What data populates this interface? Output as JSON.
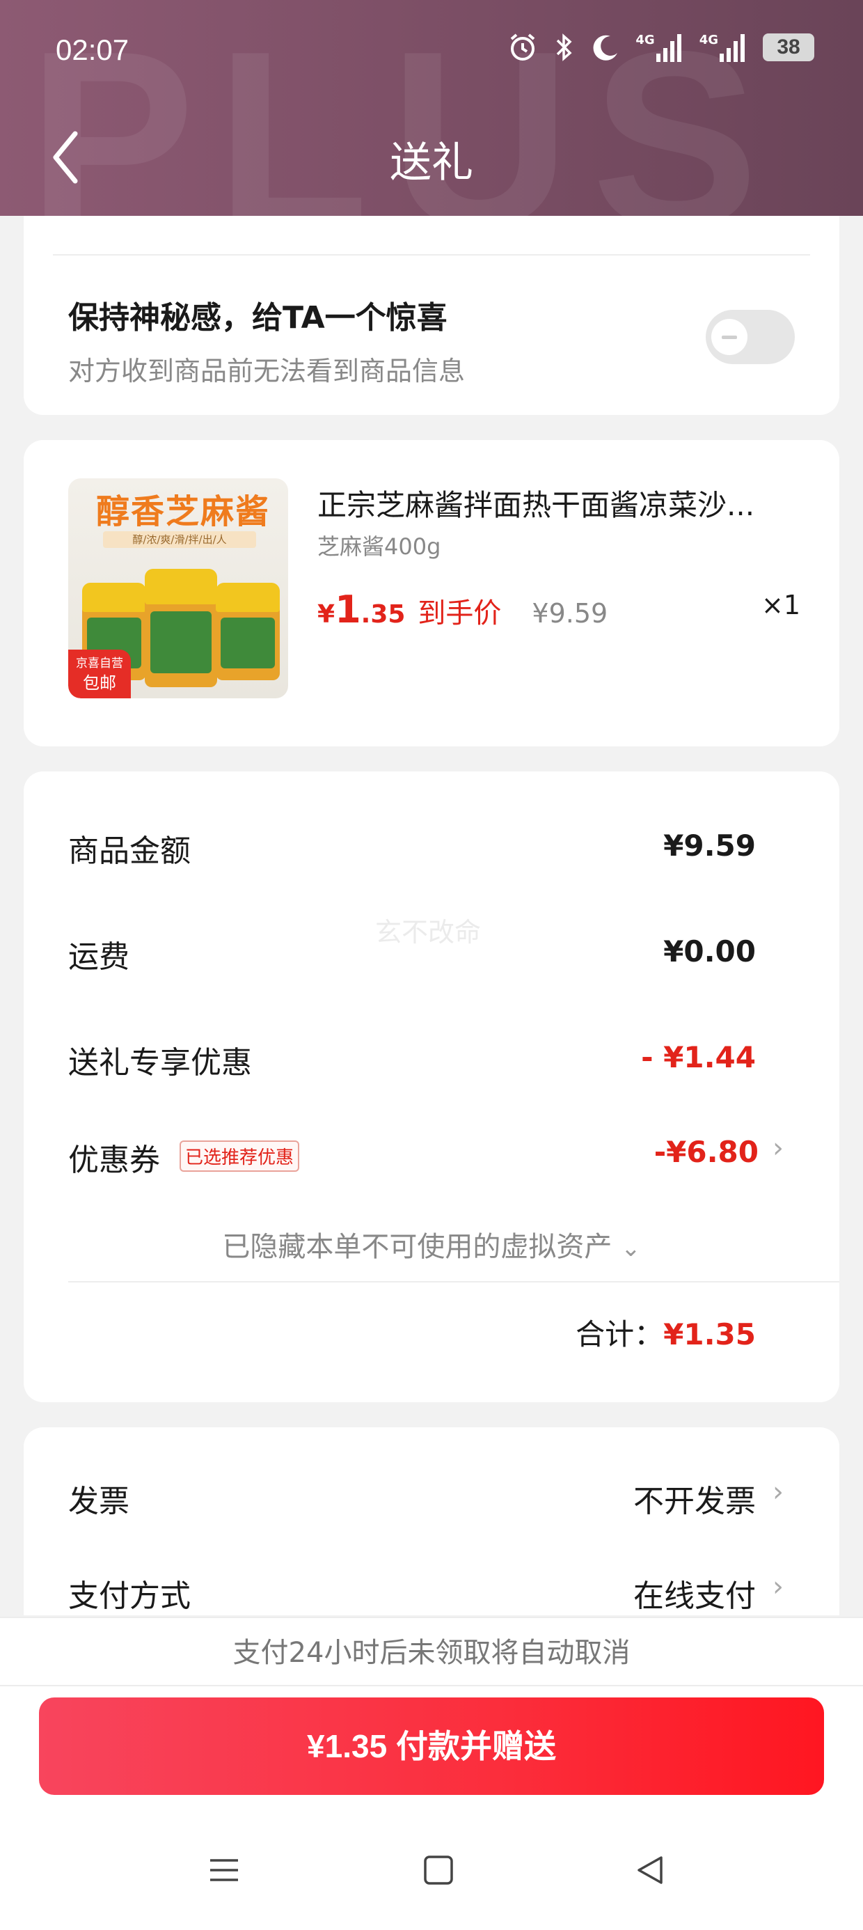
{
  "status_bar": {
    "time": "02:07",
    "network_label": "4G",
    "network_label_2": "4G",
    "battery": "38"
  },
  "header": {
    "title": "送礼",
    "watermark": "PLUS"
  },
  "secret": {
    "title": "保持神秘感，给TA一个惊喜",
    "subtitle": "对方收到商品前无法看到商品信息",
    "toggle_on": false
  },
  "product": {
    "name": "正宗芝麻酱拌面热干面酱凉菜沙...",
    "spec": "芝麻酱400g",
    "price_symbol": "¥",
    "price_int": "1",
    "price_dec": ".35",
    "price_label": "到手价",
    "original_price": "¥9.59",
    "quantity": "×1",
    "image": {
      "title": "醇香芝麻酱",
      "ribbon": "醇/浓/爽/滑/拌/出/人",
      "badge_line1": "京喜自营",
      "badge_line2": "包邮"
    }
  },
  "summary": {
    "rows": [
      {
        "label": "商品金额",
        "value": "¥9.59"
      },
      {
        "label": "运费",
        "value": "¥0.00"
      },
      {
        "label": "送礼专享优惠",
        "value": "- ¥1.44"
      },
      {
        "label": "优惠券",
        "value": "-¥6.80"
      }
    ],
    "coupon_tag": "已选推荐优惠",
    "hidden_assets": "已隐藏本单不可使用的虚拟资产",
    "total_label": "合计：",
    "total_value": "¥1.35",
    "watermark": "玄不改命"
  },
  "invoice": {
    "invoice_label": "发票",
    "invoice_value": "不开发票",
    "payment_label": "支付方式",
    "payment_value": "在线支付"
  },
  "bottom": {
    "notice": "支付24小时后未领取将自动取消",
    "pay_button": "¥1.35 付款并赠送"
  },
  "colors": {
    "accent_red": "#e2231a",
    "header_bg": "#7e5067",
    "button_red": "#fb2d3b"
  }
}
